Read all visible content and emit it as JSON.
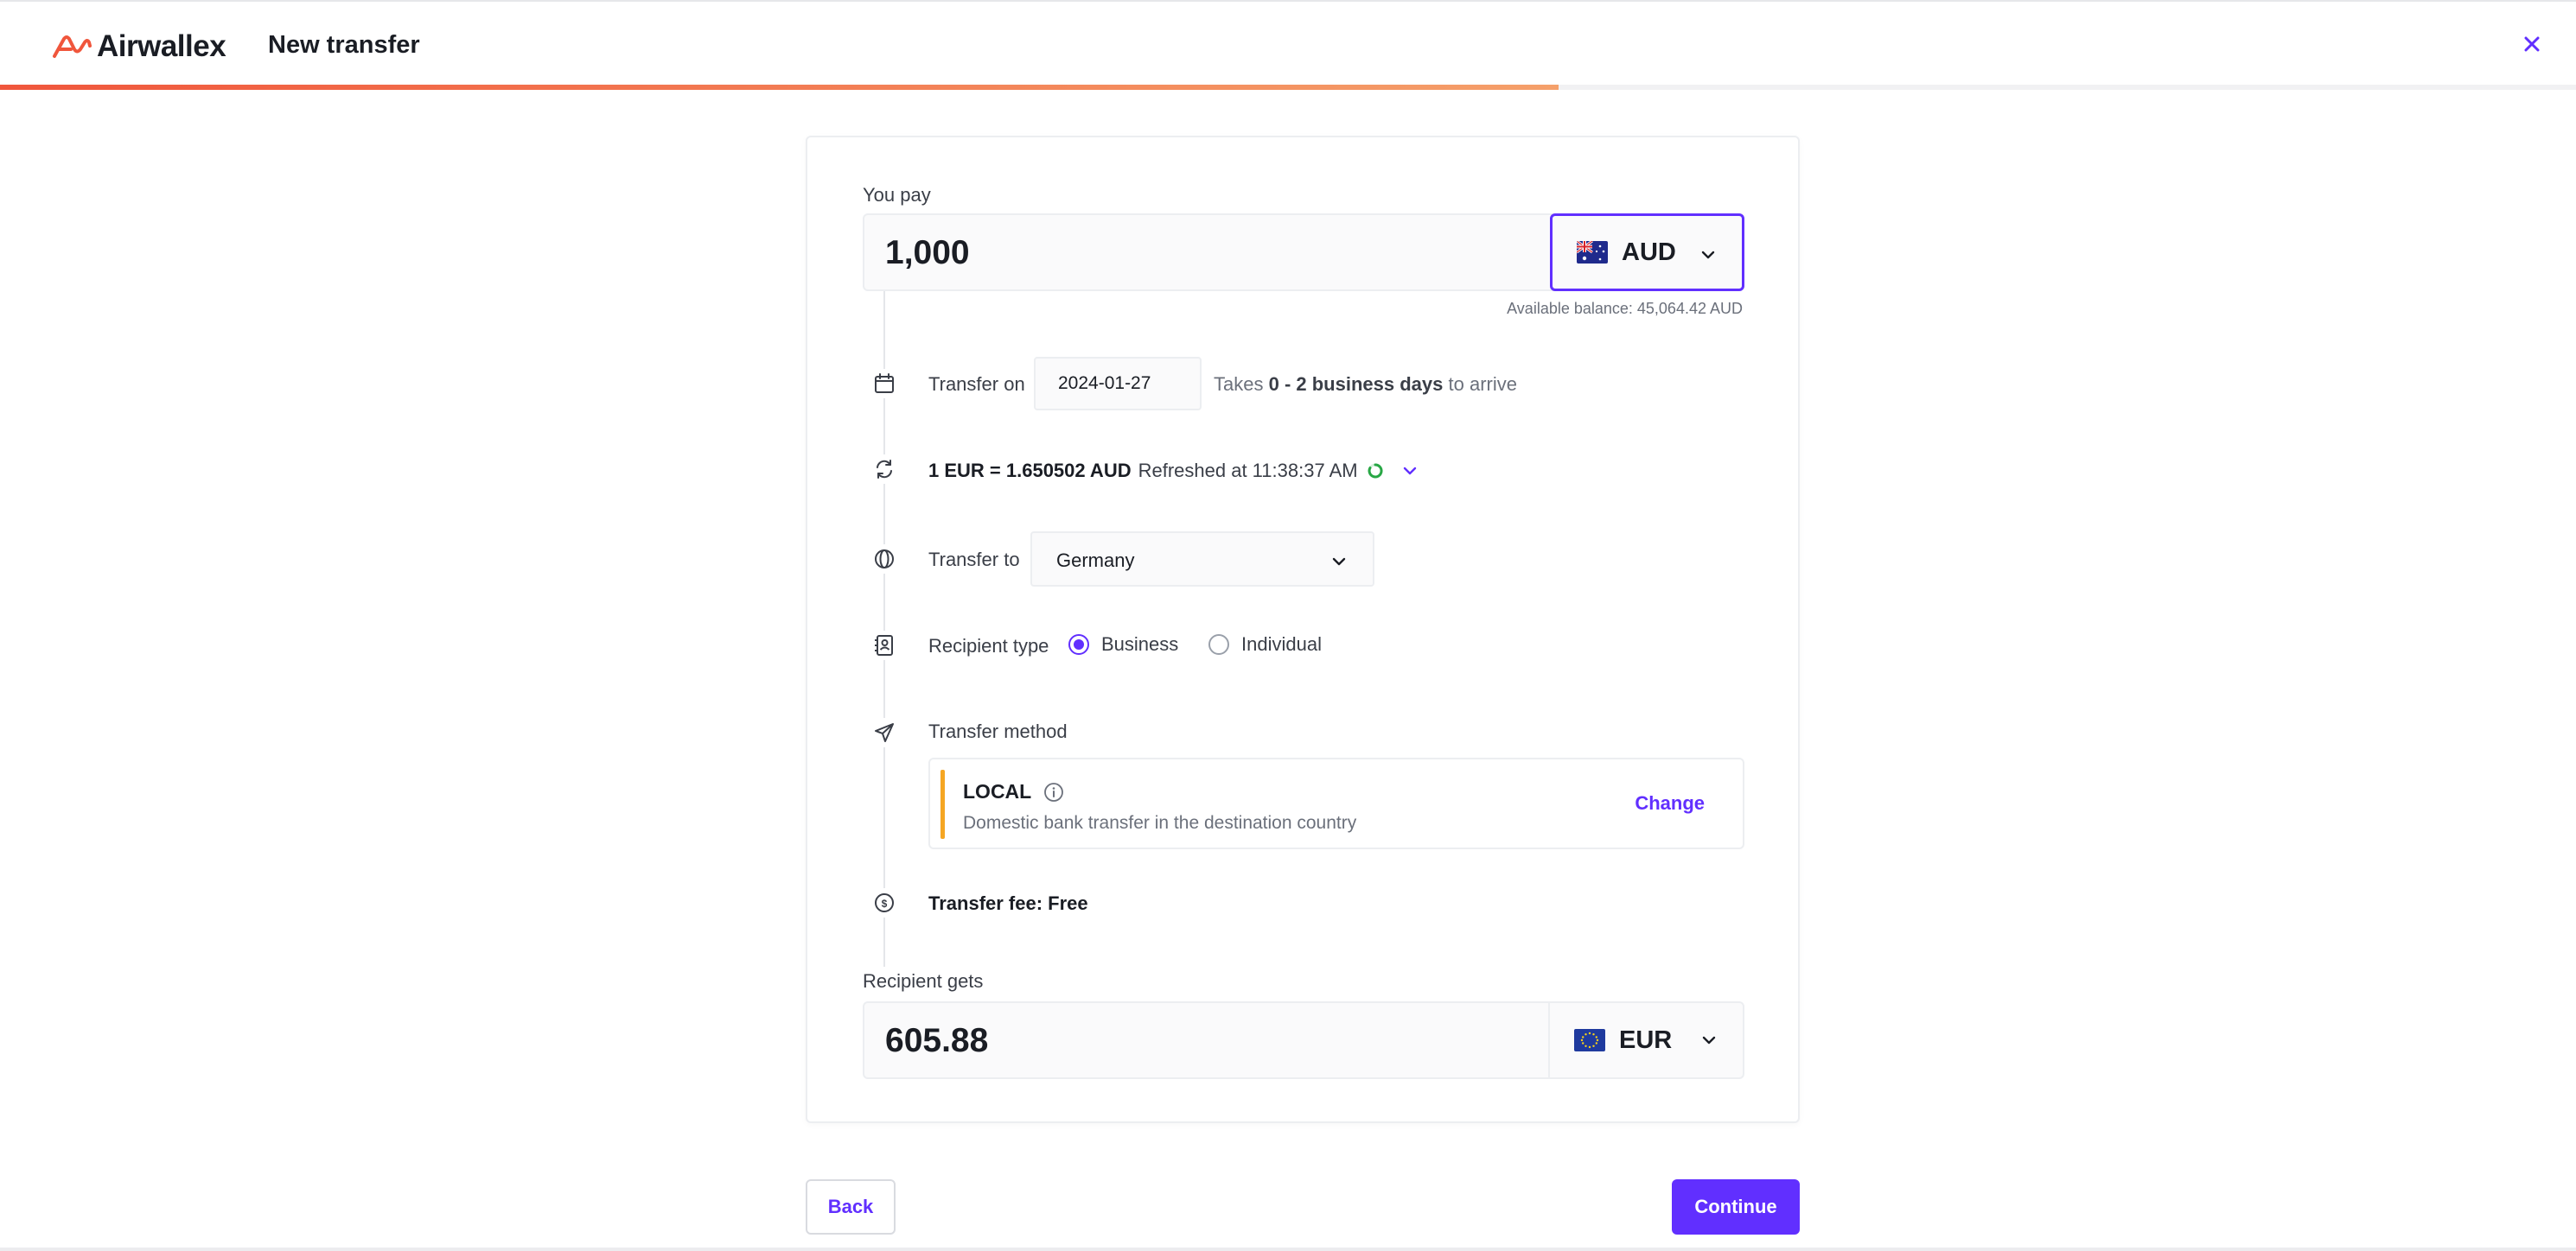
{
  "header": {
    "brand": "Airwallex",
    "title": "New transfer",
    "close_icon": "close-icon",
    "progress_fraction": 0.605
  },
  "pay": {
    "label": "You pay",
    "amount": "1,000",
    "currency": "AUD",
    "flag": "australia-flag",
    "balance": "Available balance: 45,064.42 AUD"
  },
  "transfer_date": {
    "label": "Transfer on",
    "value": "2024-01-27",
    "takes_prefix": "Takes",
    "takes_days": "0 - 2 business days",
    "takes_suffix": "to arrive"
  },
  "rate": {
    "value": "1 EUR = 1.650502 AUD",
    "refreshed": "Refreshed at 11:38:37 AM"
  },
  "destination": {
    "label": "Transfer to",
    "value": "Germany"
  },
  "recipient_type": {
    "label": "Recipient type",
    "options": [
      "Business",
      "Individual"
    ],
    "selected": "Business"
  },
  "method": {
    "label": "Transfer method",
    "name": "LOCAL",
    "description": "Domestic bank transfer in the destination country",
    "change_label": "Change"
  },
  "fee": {
    "text": "Transfer fee: Free"
  },
  "receive": {
    "label": "Recipient gets",
    "amount": "605.88",
    "currency": "EUR",
    "flag": "eu-flag"
  },
  "actions": {
    "back": "Back",
    "continue": "Continue"
  },
  "colors": {
    "accent": "#612fff",
    "brand": "#f0563c",
    "method_bar": "#f5a623"
  }
}
